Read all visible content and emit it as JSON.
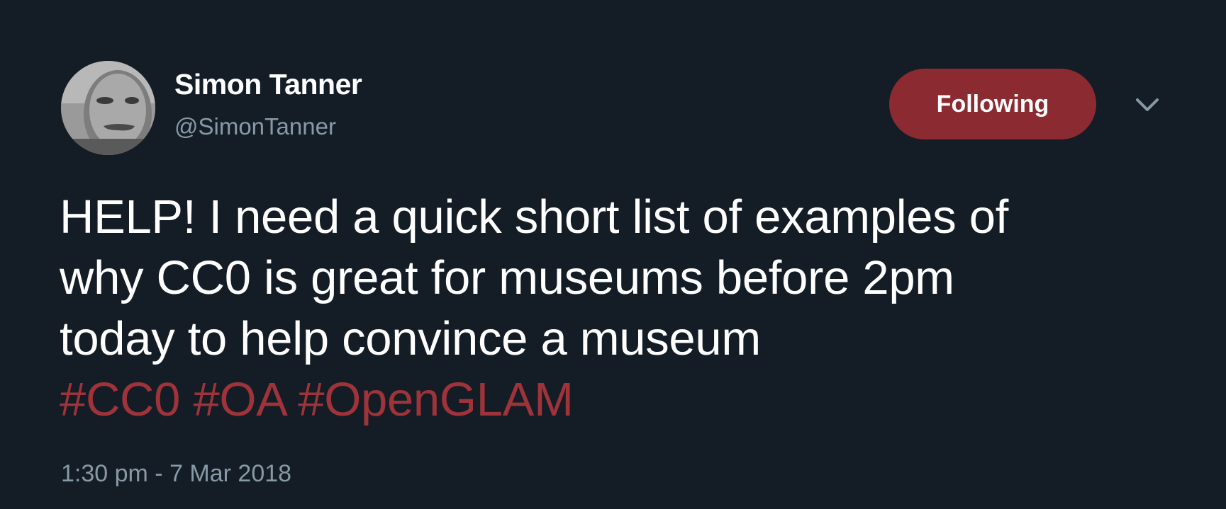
{
  "tweet": {
    "author": {
      "name": "Simon Tanner",
      "handle": "@SimonTanner"
    },
    "follow_button_label": "Following",
    "text_lines": [
      "HELP! I need a quick short list of examples of",
      "why CC0 is great for museums before 2pm",
      "today to help convince a museum"
    ],
    "hashtags": [
      "#CC0",
      "#OA",
      "#OpenGLAM"
    ],
    "timestamp": "1:30 pm - 7 Mar 2018"
  },
  "colors": {
    "background": "#141d26",
    "accent": "#8b2b31",
    "hashtag": "#a0333a",
    "secondary_text": "#8899a6"
  },
  "icons": [
    "avatar-photo",
    "chevron-down-icon"
  ]
}
